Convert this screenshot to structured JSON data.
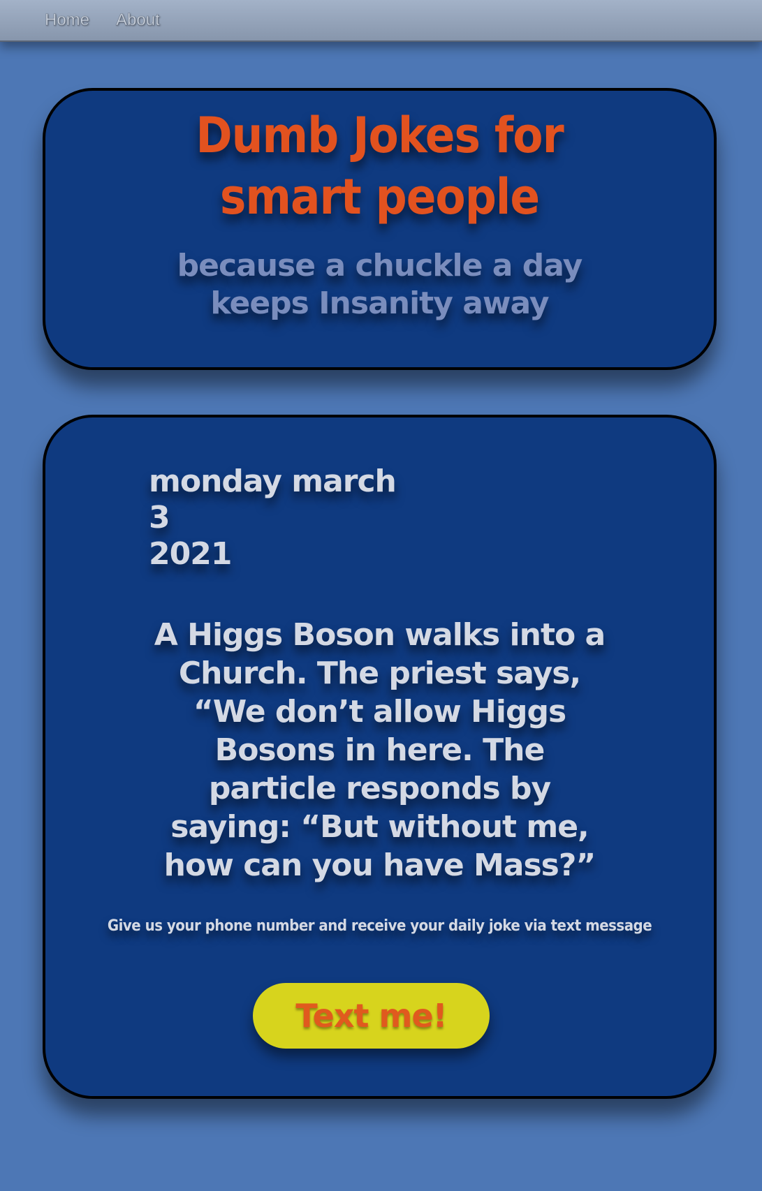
{
  "nav": {
    "items": [
      {
        "label": "Home"
      },
      {
        "label": "About"
      }
    ]
  },
  "header": {
    "title": "Dumb Jokes for smart people",
    "subtitle": "because a chuckle a day keeps Insanity away"
  },
  "joke_card": {
    "date_line1": "monday march 3",
    "date_line2": "2021",
    "joke_text": "A Higgs Boson walks into a Church. The priest says, “We don’t allow Higgs Bosons in here. The particle responds by saying: “But without me, how can you have Mass?”",
    "signup_text": "Give us your phone number and receive your daily joke via text message",
    "button_label": "Text me!"
  },
  "colors": {
    "background": "#4d77b5",
    "card": "#0f3a80",
    "title": "#e2521f",
    "button": "#d7d41d"
  }
}
